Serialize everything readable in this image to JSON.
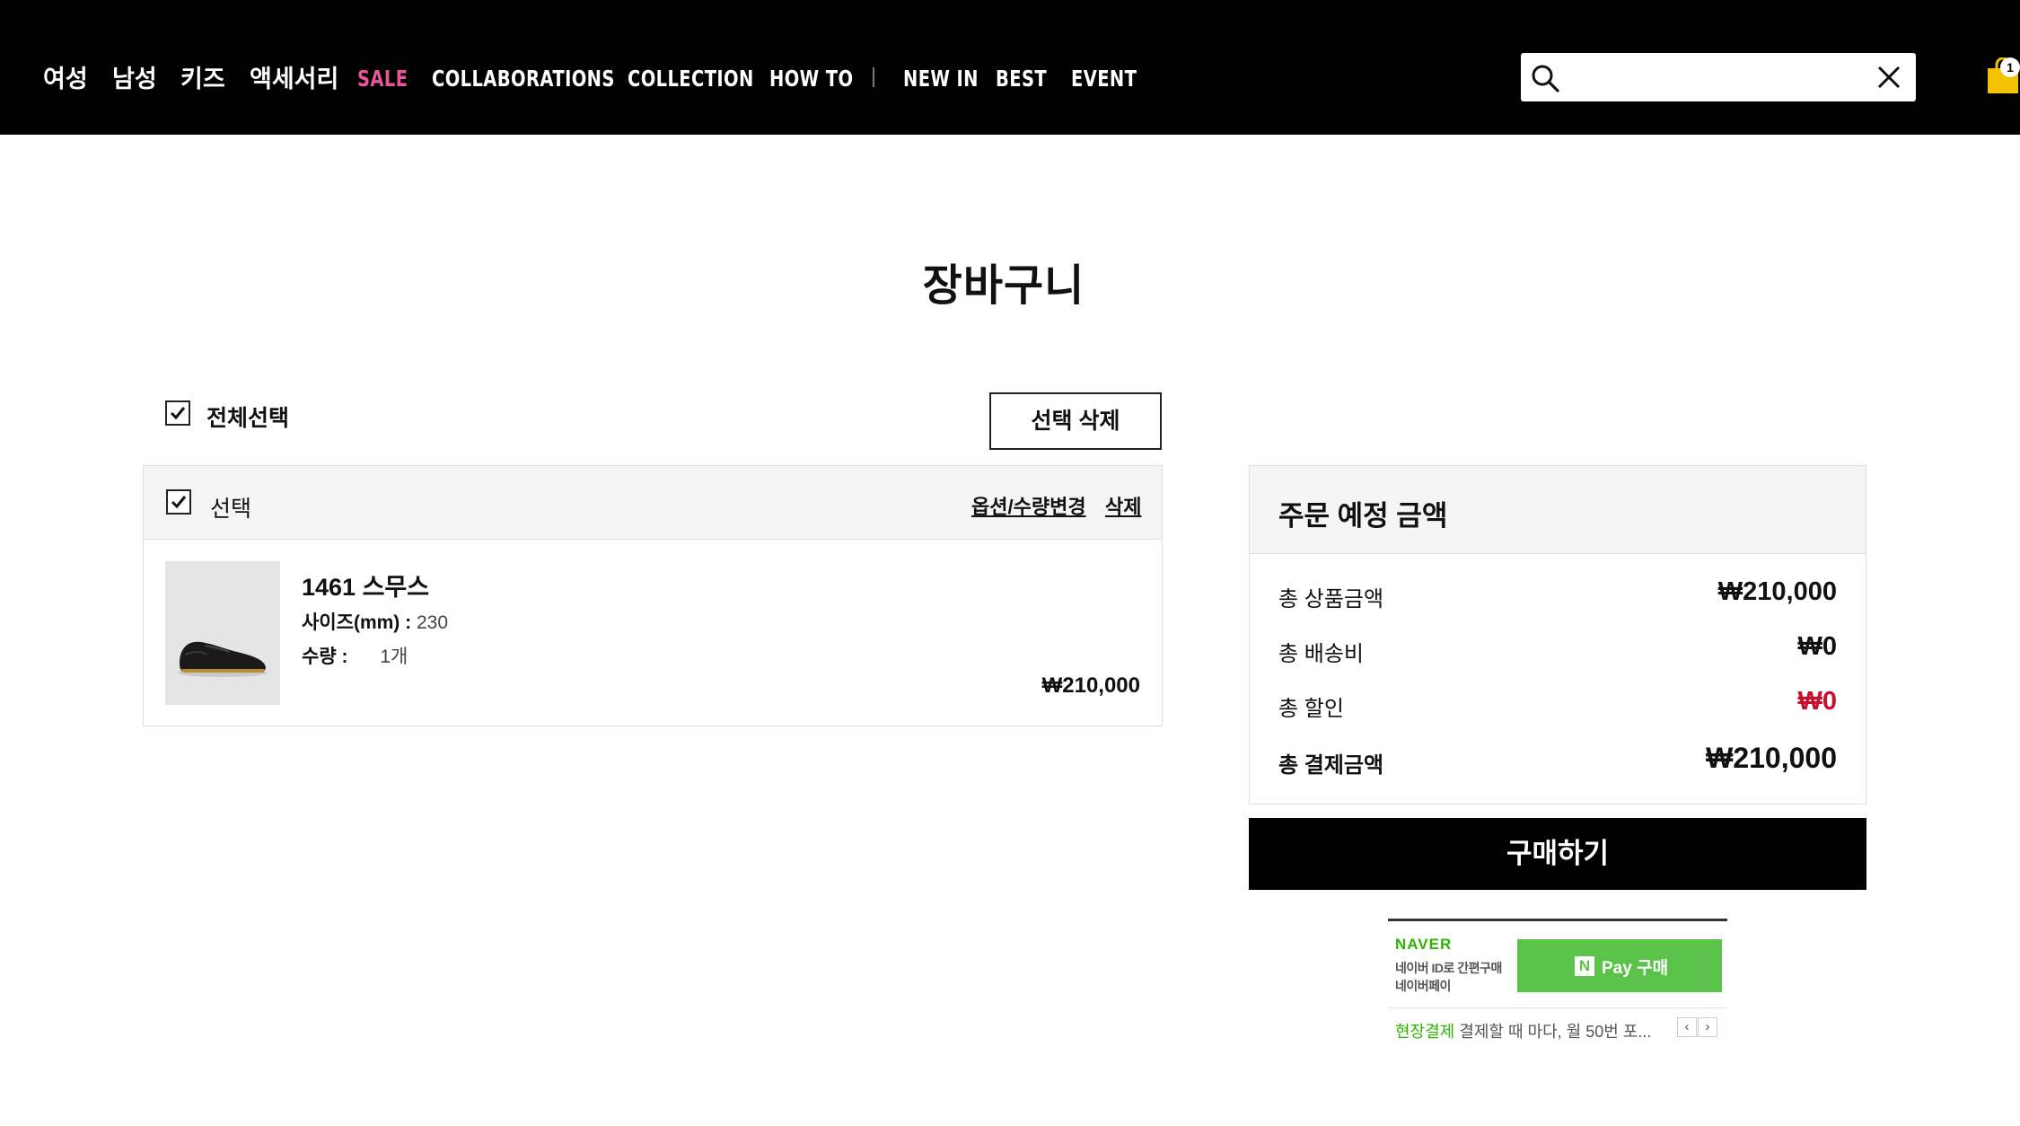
{
  "nav": {
    "items": [
      {
        "label": "여성"
      },
      {
        "label": "남성"
      },
      {
        "label": "키즈"
      },
      {
        "label": "액세서리"
      },
      {
        "label": "SALE"
      },
      {
        "label": "COLLABORATIONS"
      },
      {
        "label": "COLLECTION"
      },
      {
        "label": "HOW TO"
      },
      {
        "label": "NEW IN"
      },
      {
        "label": "BEST"
      },
      {
        "label": "EVENT"
      }
    ],
    "sale_color": "#e8559a"
  },
  "search": {
    "value": "",
    "placeholder": ""
  },
  "cart_badge": "1",
  "page_title": "장바구니",
  "select_all_label": "전체선택",
  "delete_selected_label": "선택 삭제",
  "item": {
    "select_label": "선택",
    "option_change_label": "옵션/수량변경",
    "delete_label": "삭제",
    "name": "1461 스무스",
    "size_label": "사이즈(mm) :",
    "size_value": "230",
    "qty_label": "수량 :",
    "qty_value": "1개",
    "price": "₩210,000",
    "image_icon": "black-leather-shoe-icon"
  },
  "summary": {
    "title": "주문 예정 금액",
    "rows": [
      {
        "label": "총 상품금액",
        "value": "₩210,000"
      },
      {
        "label": "총 배송비",
        "value": "₩0"
      },
      {
        "label": "총 할인",
        "value": "₩0"
      },
      {
        "label": "총 결제금액",
        "value": "₩210,000"
      }
    ],
    "discount_color": "#c8102e"
  },
  "buy_button_label": "구매하기",
  "naver_pay": {
    "logo": "NAVER",
    "sub1": "네이버 ID로 간편구매",
    "sub2": "네이버페이",
    "button_n": "N",
    "button_label": "Pay 구매",
    "foot_highlight": "현장결제",
    "foot_text": "결제할 때 마다, 월 50번 포...",
    "prev": "‹",
    "next": "›",
    "brand_color": "#5cc34a"
  }
}
